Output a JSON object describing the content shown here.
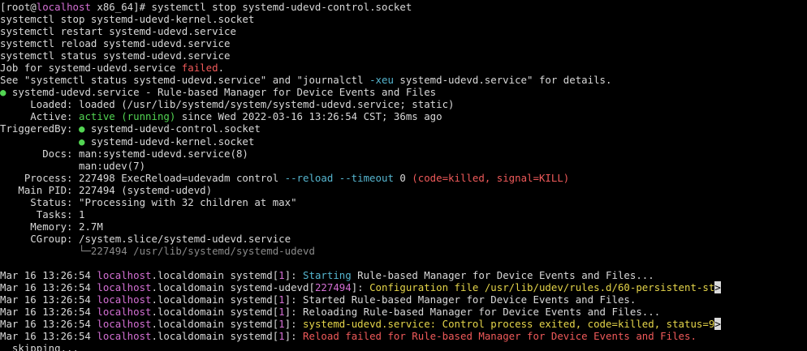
{
  "prompt": {
    "open": "[root@",
    "host": "localhost",
    "rest": " x86_64]# ",
    "command": "systemctl stop systemd-udevd-control.socket"
  },
  "echo_lines": [
    "systemctl stop systemd-udevd-kernel.socket",
    "systemctl restart systemd-udevd.service",
    "systemctl reload systemd-udevd.service",
    "systemctl status systemd-udevd.service"
  ],
  "job": {
    "prefix": "Job for systemd-udevd.service ",
    "status": "failed",
    "suffix": "."
  },
  "see": {
    "prefix": "See \"systemctl status systemd-udevd.service\" and \"journalctl ",
    "flag": "-xeu",
    "suffix": " systemd-udevd.service\" for details."
  },
  "status": {
    "dot": "●",
    "header": " systemd-udevd.service - Rule-based Manager for Device Events and Files",
    "loaded_label": "     Loaded: ",
    "loaded_value": "loaded (/usr/lib/systemd/system/systemd-udevd.service; static)",
    "active_label": "     Active: ",
    "active_state": "active (running)",
    "active_rest": " since Wed 2022-03-16 13:26:54 CST; 36ms ago",
    "triggered_label": "TriggeredBy: ",
    "triggered_1": " systemd-udevd-control.socket",
    "triggered_indent": "             ",
    "triggered_2": " systemd-udevd-kernel.socket",
    "docs_label": "       Docs: ",
    "docs_1": "man:systemd-udevd.service(8)",
    "docs_indent": "             ",
    "docs_2": "man:udev(7)",
    "process_label": "    Process: ",
    "process_a": "227498 ExecReload=udevadm control ",
    "process_flags": "--reload --timeout",
    "process_b": " 0 ",
    "process_killed": "(code=killed, signal=KILL)",
    "mainpid_label": "   Main PID: ",
    "mainpid_value": "227494 (systemd-udevd)",
    "statusline_label": "     Status: ",
    "statusline_value": "\"Processing with 32 children at max\"",
    "tasks_label": "      Tasks: ",
    "tasks_value": "1",
    "memory_label": "     Memory: ",
    "memory_value": "2.7M",
    "cgroup_label": "     CGroup: ",
    "cgroup_value": "/system.slice/systemd-udevd.service",
    "cgroup_indent": "             ",
    "cgroup_child": "└─227494 /usr/lib/systemd/systemd-udevd"
  },
  "journal": [
    {
      "ts": "Mar 16 13:26:54 ",
      "host": "localhost",
      "domain": ".localdomain ",
      "proc": "systemd",
      "pid": "1",
      "msg_colored": "Starting",
      "msg_plain": " Rule-based Manager for Device Events and Files...",
      "msg_color": "cyan"
    },
    {
      "ts": "Mar 16 13:26:54 ",
      "host": "localhost",
      "domain": ".localdomain ",
      "proc": "systemd-udevd",
      "pid": "227494",
      "msg_colored": "Configuration file /usr/lib/udev/rules.d/60-persistent-st",
      "msg_plain": "",
      "msg_color": "yellow",
      "trunc": ">"
    },
    {
      "ts": "Mar 16 13:26:54 ",
      "host": "localhost",
      "domain": ".localdomain ",
      "proc": "systemd",
      "pid": "1",
      "msg_colored": "",
      "msg_plain": "Started Rule-based Manager for Device Events and Files.",
      "msg_color": "plain"
    },
    {
      "ts": "Mar 16 13:26:54 ",
      "host": "localhost",
      "domain": ".localdomain ",
      "proc": "systemd",
      "pid": "1",
      "msg_colored": "",
      "msg_plain": "Reloading Rule-based Manager for Device Events and Files...",
      "msg_color": "plain"
    },
    {
      "ts": "Mar 16 13:26:54 ",
      "host": "localhost",
      "domain": ".localdomain ",
      "proc": "systemd",
      "pid": "1",
      "msg_colored": "systemd-udevd.service: Control process exited, code=killed, status=9",
      "msg_plain": "",
      "msg_color": "yellow",
      "trunc": ">"
    },
    {
      "ts": "Mar 16 13:26:54 ",
      "host": "localhost",
      "domain": ".localdomain ",
      "proc": "systemd",
      "pid": "1",
      "msg_colored": "Reload failed for Rule-based Manager for Device Events and Files.",
      "msg_plain": "",
      "msg_color": "red"
    }
  ],
  "last_line": "  skipping...",
  "colors": {
    "background": "#000000",
    "text": "#d9d9d9",
    "hostname": "#d470d4",
    "failed": "#f05a5a",
    "active": "#52d452",
    "flag": "#56b6d0",
    "warning": "#e5d54a",
    "dim": "#8a8a8a"
  }
}
